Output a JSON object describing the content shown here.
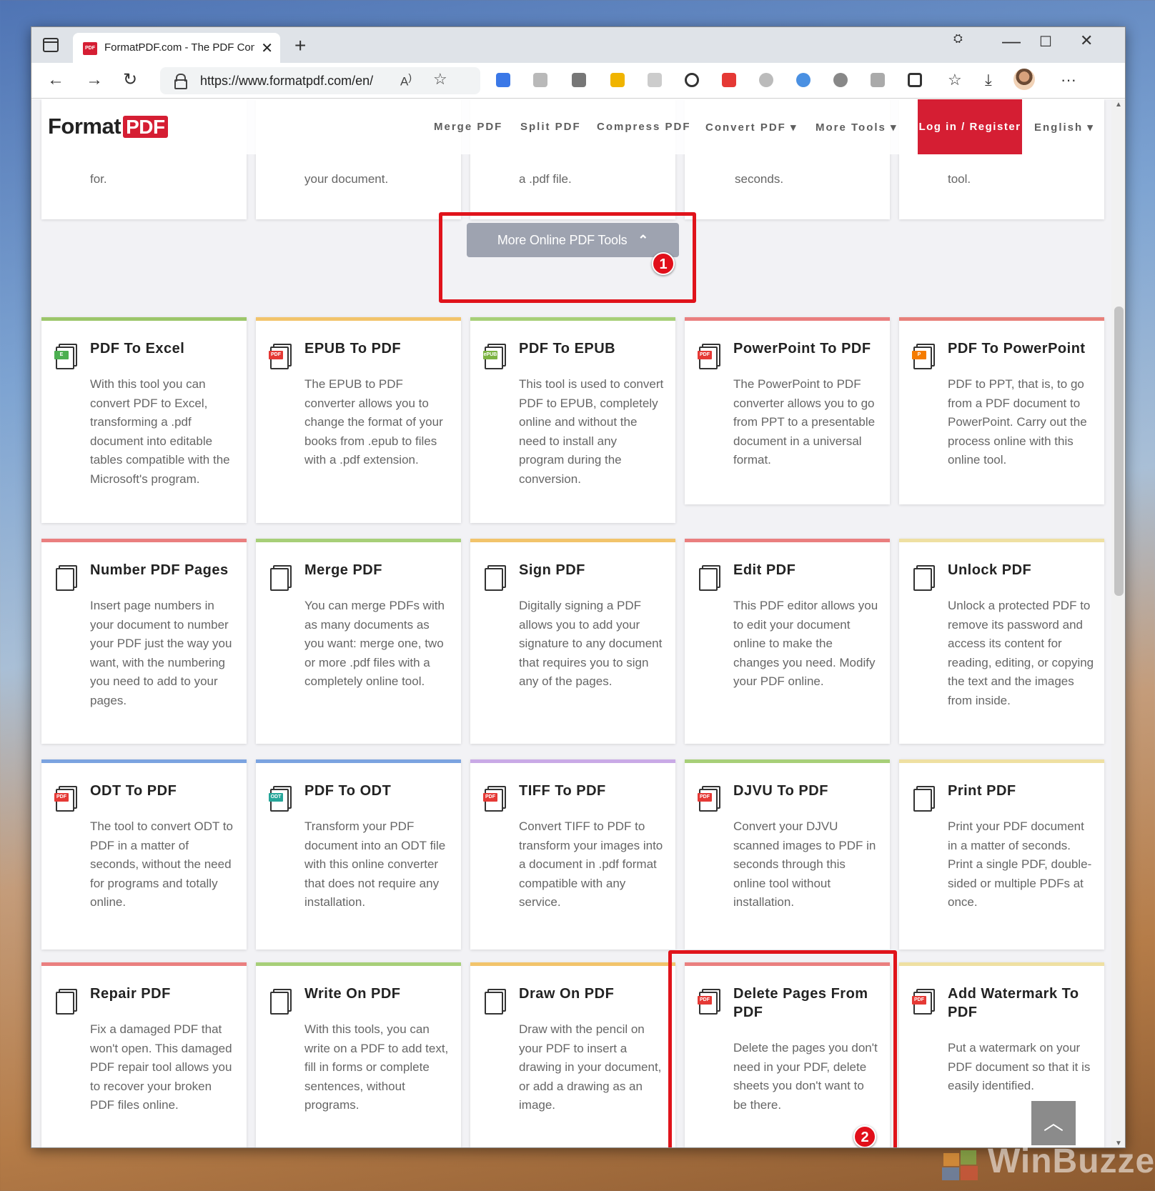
{
  "browser": {
    "tab_title": "FormatPDF.com - The PDF Conve",
    "favicon_text": "PDF",
    "url": "https://www.formatpdf.com/en/",
    "extension_icons": [
      "translate-icon",
      "grammar-icon",
      "pen-icon",
      "key-icon",
      "window-icon",
      "link-icon",
      "calendar-badge-icon",
      "k-icon",
      "shield-icon",
      "globe-icon",
      "signature-icon",
      "extensions-icon"
    ]
  },
  "site": {
    "logo_text": "Format",
    "logo_badge": "PDF",
    "menu": [
      "Merge PDF",
      "Split PDF",
      "Compress PDF",
      "Convert PDF ▾",
      "More Tools ▾"
    ],
    "login": "Log in / Register",
    "language": "English ▾",
    "more_tools_button": "More Online PDF Tools"
  },
  "top_cards": [
    {
      "text": "for."
    },
    {
      "text": "your document."
    },
    {
      "text": "a .pdf file."
    },
    {
      "text": "seconds."
    },
    {
      "text": "tool."
    }
  ],
  "tools": [
    {
      "title": "PDF To Excel",
      "desc": "With this tool you can convert PDF to Excel, transforming a .pdf document into editable tables compatible with the Microsoft's program.",
      "color": "#9cc66a",
      "tag": "E",
      "tag_color": "#4caf50"
    },
    {
      "title": "EPUB To PDF",
      "desc": "The EPUB to PDF converter allows you to change the format of your books from .epub to files with a .pdf extension.",
      "color": "#f2c46b",
      "tag": "PDF",
      "tag_color": "#e53935"
    },
    {
      "title": "PDF To EPUB",
      "desc": "This tool is used to convert PDF to EPUB, completely online and without the need to install any program during the conversion.",
      "color": "#a7cf78",
      "tag": "ePUB",
      "tag_color": "#7cb342"
    },
    {
      "title": "PowerPoint To PDF",
      "desc": "The PowerPoint to PDF converter allows you to go from PPT to a presentable document in a universal format.",
      "color": "#ea7f7f",
      "tag": "PDF",
      "tag_color": "#e53935"
    },
    {
      "title": "PDF To PowerPoint",
      "desc": "PDF to PPT, that is, to go from a PDF document to PowerPoint. Carry out the process online with this online tool.",
      "color": "#e8807a",
      "tag": "P",
      "tag_color": "#f57c00"
    },
    {
      "title": "Number PDF Pages",
      "desc": "Insert page numbers in your document to number your PDF just the way you want, with the numbering you need to add to your pages.",
      "color": "#ea7f7f",
      "tag": "",
      "tag_color": "#e53935"
    },
    {
      "title": "Merge PDF",
      "desc": "You can merge PDFs with as many documents as you want: merge one, two or more .pdf files with a completely online tool.",
      "color": "#a7cf78",
      "tag": "",
      "tag_color": "#e53935"
    },
    {
      "title": "Sign PDF",
      "desc": "Digitally signing a PDF allows you to add your signature to any document that requires you to sign any of the pages.",
      "color": "#f2c46b",
      "tag": "",
      "tag_color": "#e53935"
    },
    {
      "title": "Edit PDF",
      "desc": "This PDF editor allows you to edit your document online to make the changes you need. Modify your PDF online.",
      "color": "#ea7f7f",
      "tag": "",
      "tag_color": "#e53935"
    },
    {
      "title": "Unlock PDF",
      "desc": "Unlock a protected PDF to remove its password and access its content for reading, editing, or copying the text and the images from inside.",
      "color": "#efe0a2",
      "tag": "",
      "tag_color": "#e53935"
    },
    {
      "title": "ODT To PDF",
      "desc": "The tool to convert ODT to PDF in a matter of seconds, without the need for programs and totally online.",
      "color": "#7ba3e0",
      "tag": "PDF",
      "tag_color": "#e53935"
    },
    {
      "title": "PDF To ODT",
      "desc": "Transform your PDF document into an ODT file with this online converter that does not require any installation.",
      "color": "#7ba3e0",
      "tag": "ODT",
      "tag_color": "#26a69a"
    },
    {
      "title": "TIFF To PDF",
      "desc": "Convert TIFF to PDF to transform your images into a document in .pdf format compatible with any service.",
      "color": "#c9a9e6",
      "tag": "PDF",
      "tag_color": "#e53935"
    },
    {
      "title": "DJVU To PDF",
      "desc": "Convert your DJVU scanned images to PDF in seconds through this online tool without installation.",
      "color": "#a7cf78",
      "tag": "PDF",
      "tag_color": "#e53935"
    },
    {
      "title": "Print PDF",
      "desc": "Print your PDF document in a matter of seconds. Print a single PDF, double-sided or multiple PDFs at once.",
      "color": "#efe0a2",
      "tag": "",
      "tag_color": "#e53935"
    },
    {
      "title": "Repair PDF",
      "desc": "Fix a damaged PDF that won't open. This damaged PDF repair tool allows you to recover your broken PDF files online.",
      "color": "#ea7f7f",
      "tag": "",
      "tag_color": "#e53935"
    },
    {
      "title": "Write On PDF",
      "desc": "With this tools, you can write on a PDF to add text, fill in forms or complete sentences, without programs.",
      "color": "#a7cf78",
      "tag": "",
      "tag_color": "#e53935"
    },
    {
      "title": "Draw On PDF",
      "desc": "Draw with the pencil on your PDF to insert a drawing in your document, or add a drawing as an image.",
      "color": "#f2c46b",
      "tag": "",
      "tag_color": "#e53935"
    },
    {
      "title": "Delete Pages From PDF",
      "desc": "Delete the pages you don't need in your PDF, delete sheets you don't want to be there.",
      "color": "#ea7f7f",
      "tag": "PDF",
      "tag_color": "#e53935"
    },
    {
      "title": "Add Watermark To PDF",
      "desc": "Put a watermark on your PDF document so that it is easily identified.",
      "color": "#efe0a2",
      "tag": "PDF",
      "tag_color": "#e53935"
    }
  ],
  "annotations": {
    "badge1": "1",
    "badge2": "2"
  },
  "scroll_top_icon": "chevron-up-icon",
  "watermark": "WinBuzzer"
}
